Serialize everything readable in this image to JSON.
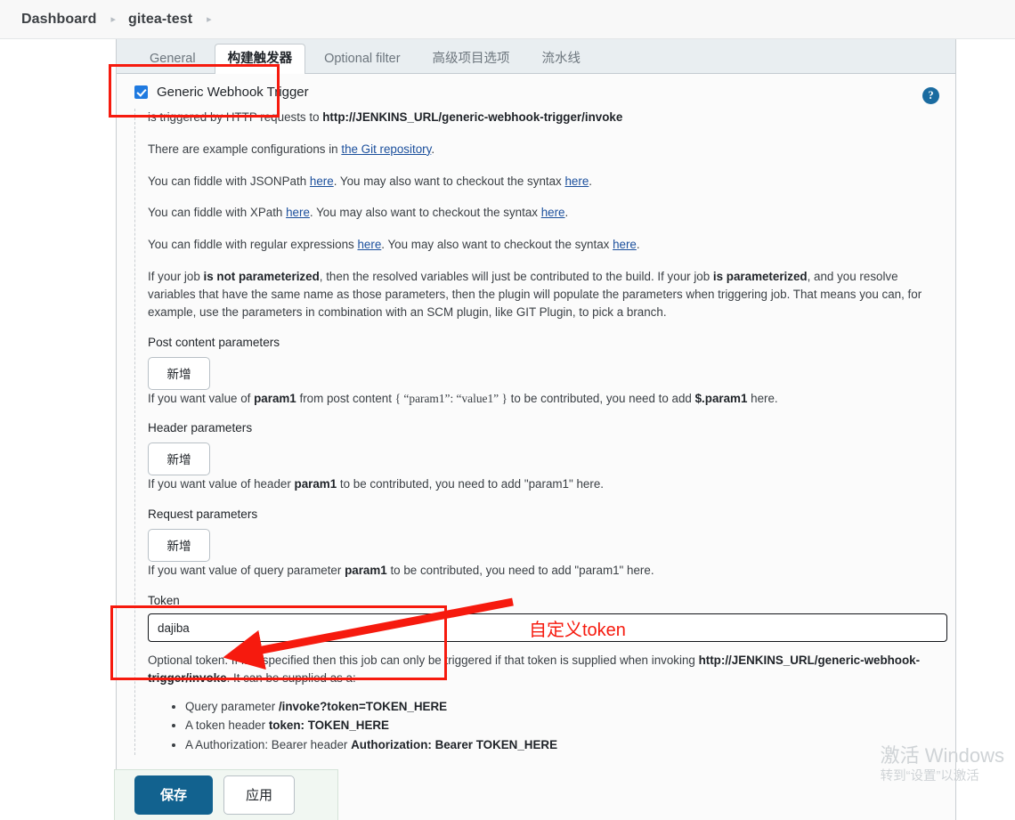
{
  "breadcrumb": {
    "items": [
      "Dashboard",
      "gitea-test"
    ],
    "separator": "▸",
    "trailing_separator": "▸"
  },
  "tabs": [
    {
      "label": "General",
      "active": false
    },
    {
      "label": "构建触发器",
      "active": true
    },
    {
      "label": "Optional filter",
      "active": false
    },
    {
      "label": "高级项目选项",
      "active": false
    },
    {
      "label": "流水线",
      "active": false
    }
  ],
  "trigger": {
    "checkbox_label": "Generic Webhook Trigger",
    "checked": true,
    "help_icon": "question-mark-icon",
    "help_label": "?"
  },
  "body": {
    "line_invoke_prefix": "is triggered by HTTP requests to ",
    "line_invoke_url": "http://JENKINS_URL/generic-webhook-trigger/invoke",
    "examples_prefix": "There are example configurations in ",
    "examples_link": "the Git repository",
    "examples_suffix": ".",
    "fiddle_jsonpath": {
      "prefix": "You can fiddle with JSONPath ",
      "link1": "here",
      "mid": ". You may also want to checkout the syntax ",
      "link2": "here",
      "suffix": "."
    },
    "fiddle_xpath": {
      "prefix": "You can fiddle with XPath ",
      "link1": "here",
      "mid": ". You may also want to checkout the syntax ",
      "link2": "here",
      "suffix": "."
    },
    "fiddle_regex": {
      "prefix": "You can fiddle with regular expressions ",
      "link1": "here",
      "mid": ". You may also want to checkout the syntax ",
      "link2": "here",
      "suffix": "."
    },
    "parameterized": {
      "p1": "If your job ",
      "b1": "is not parameterized",
      "p2": ", then the resolved variables will just be contributed to the build. If your job ",
      "b2": "is parameterized",
      "p3": ", and you resolve variables that have the same name as those parameters, then the plugin will populate the parameters when triggering job. That means you can, for example, use the parameters in combination with an SCM plugin, like GIT Plugin, to pick a branch."
    }
  },
  "sections": {
    "post_content": {
      "title": "Post content parameters",
      "add_label": "新增",
      "hint_p1": "If you want value of ",
      "hint_b1": "param1",
      "hint_p2": " from post content ",
      "hint_code": "{ “param1”: “value1” }",
      "hint_p3": " to be contributed, you need to add ",
      "hint_b2": "$.param1",
      "hint_p4": " here."
    },
    "header": {
      "title": "Header parameters",
      "add_label": "新增",
      "hint_p1": "If you want value of header ",
      "hint_b1": "param1",
      "hint_p2": " to be contributed, you need to add \"param1\" here."
    },
    "request": {
      "title": "Request parameters",
      "add_label": "新增",
      "hint_p1": "If you want value of query parameter ",
      "hint_b1": "param1",
      "hint_p2": " to be contributed, you need to add \"param1\" here."
    },
    "token": {
      "title": "Token",
      "value": "dajiba",
      "placeholder": "",
      "desc_p1": "Optional token. If it is specified then this job can only be triggered if that token is supplied when invoking ",
      "desc_b1": "http://JENKINS_URL/generic-webhook-trigger/invoke",
      "desc_p2": ". It can be supplied as a:",
      "bullets": [
        {
          "prefix": "Query parameter ",
          "bold": "/invoke?token=TOKEN_HERE",
          "suffix": ""
        },
        {
          "prefix": "A token header ",
          "bold": "token: TOKEN_HERE",
          "suffix": ""
        },
        {
          "prefix": "A Authorization: Bearer header ",
          "bold": "Authorization: Bearer TOKEN_HERE",
          "suffix": ""
        }
      ]
    }
  },
  "save_bar": {
    "save_label": "保存",
    "apply_label": "应用"
  },
  "annotations": {
    "token_note": "自定义token",
    "color": "#f61a0e"
  },
  "watermark": {
    "line1": "激活 Windows",
    "line2": "转到“设置”以激活"
  },
  "colors": {
    "accent_blue": "#12628f",
    "checkbox_blue": "#1f7ae0",
    "link_blue": "#1b4f9c",
    "annotation_red": "#f61a0e",
    "tabbar_bg": "#e9eef1",
    "panel_bg": "#fbfbfb",
    "save_bar_bg": "#f1f7f2"
  }
}
